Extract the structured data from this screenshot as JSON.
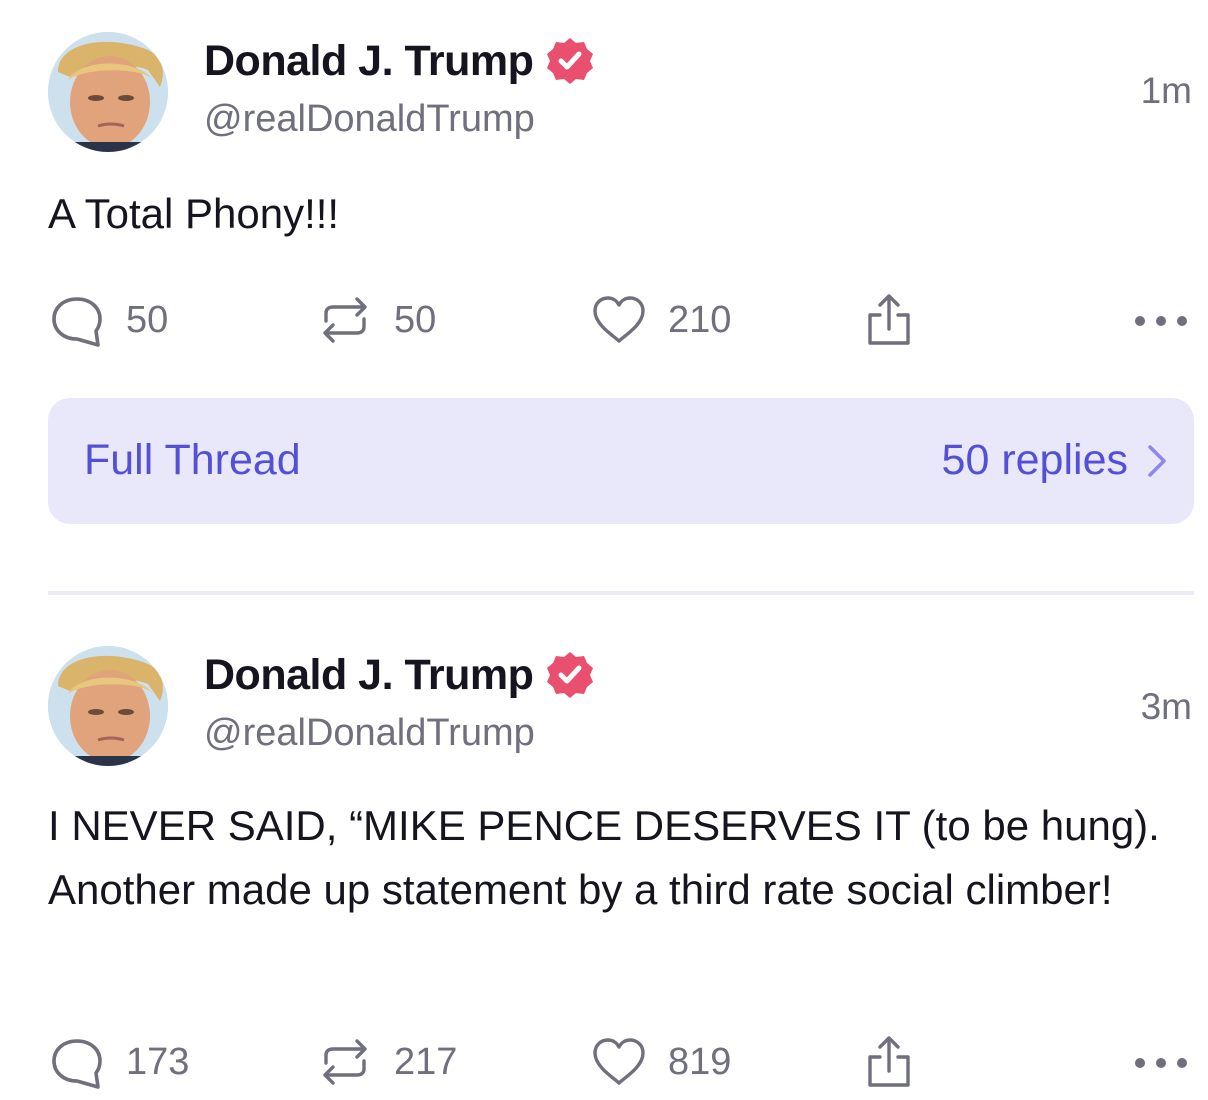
{
  "colors": {
    "verified": "#e94f6f",
    "accent": "#5450d6",
    "thread_bg": "#e9e8fb",
    "muted": "#6f6f7d"
  },
  "posts": [
    {
      "author_name": "Donald J. Trump",
      "handle": "@realDonaldTrump",
      "time": "1m",
      "text": "A Total Phony!!!",
      "replies": "50",
      "reposts": "50",
      "likes": "210",
      "thread": {
        "label": "Full Thread",
        "replies_label": "50 replies"
      }
    },
    {
      "author_name": "Donald J. Trump",
      "handle": "@realDonaldTrump",
      "time": "3m",
      "text": "I NEVER SAID, “MIKE PENCE DESERVES IT (to be hung). Another made up statement by a third rate social climber!",
      "replies": "173",
      "reposts": "217",
      "likes": "819"
    }
  ],
  "icons": {
    "reply": "speech-bubble-icon",
    "repost": "repost-arrows-icon",
    "like": "heart-icon",
    "share": "share-upload-icon",
    "more": "ellipsis-icon",
    "verified": "verified-badge-icon",
    "chevron": "chevron-right-icon"
  }
}
